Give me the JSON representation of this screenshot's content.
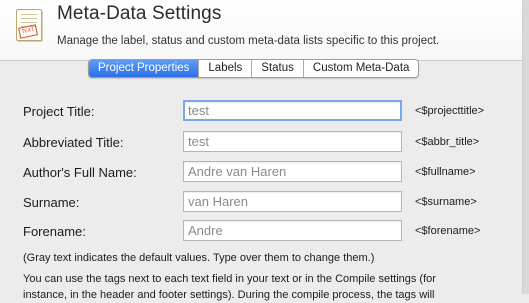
{
  "header": {
    "title": "Meta-Data Settings",
    "subtitle": "Manage the label, status and custom meta-data lists specific to this project."
  },
  "tabs": [
    {
      "label": "Project Properties",
      "active": true
    },
    {
      "label": "Labels",
      "active": false
    },
    {
      "label": "Status",
      "active": false
    },
    {
      "label": "Custom Meta-Data",
      "active": false
    }
  ],
  "fields": [
    {
      "label": "Project Title:",
      "value": "test",
      "tag": "<$projecttitle>"
    },
    {
      "label": "Abbreviated Title:",
      "value": "test",
      "tag": "<$abbr_title>"
    },
    {
      "label": "Author's Full Name:",
      "value": "Andre van Haren",
      "tag": "<$fullname>"
    },
    {
      "label": "Surname:",
      "value": "van Haren",
      "tag": "<$surname>"
    },
    {
      "label": "Forename:",
      "value": "Andre",
      "tag": "<$forename>"
    }
  ],
  "note": "(Gray text indicates the default values. Type over them to change them.)",
  "paragraph": {
    "line1": "You can use the tags next to each text field in your text or in the Compile settings (for",
    "line2": "instance, in the header and footer settings). During the compile process, the tags will"
  }
}
